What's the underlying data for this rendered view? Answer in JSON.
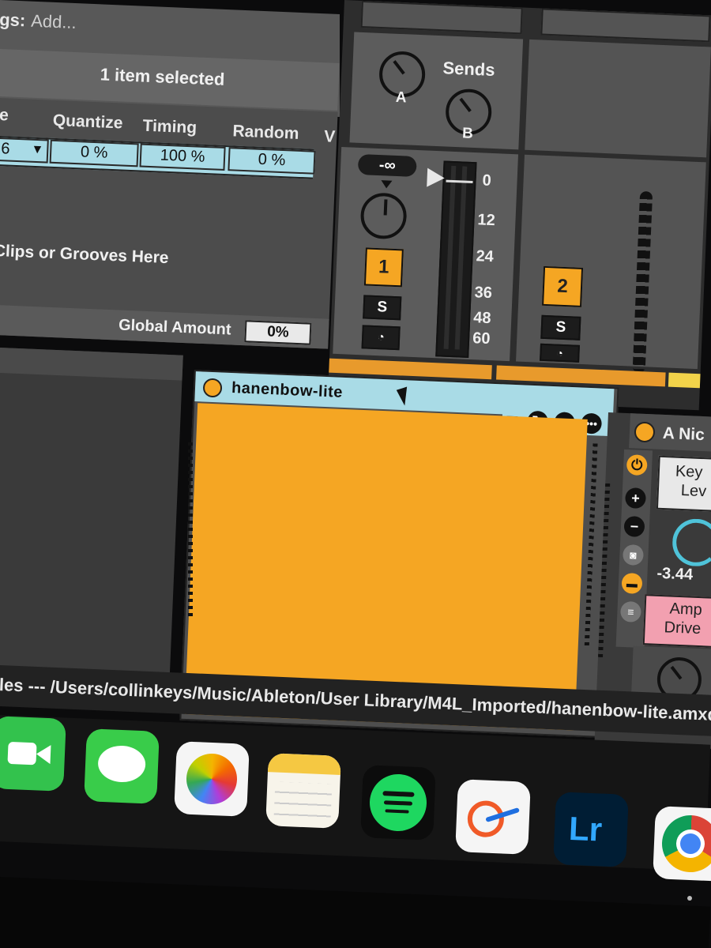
{
  "browser": {
    "tags_label": "gs:",
    "tags_placeholder": "Add...",
    "selection_status": "1 item selected"
  },
  "groove": {
    "col_partial_left": "e",
    "columns": [
      "Quantize",
      "Timing",
      "Random",
      "V"
    ],
    "row_partial_left": "6",
    "values": [
      "0 %",
      "100 %",
      "0 %"
    ],
    "drop_hint": "Clips or Grooves Here",
    "global_amount_label": "Global Amount",
    "global_amount_value": "0%"
  },
  "mixer": {
    "sends_label": "Sends",
    "send_a": "A",
    "send_b": "B",
    "volume_readout": "-∞",
    "meter_ticks": [
      "0",
      "12",
      "24",
      "36",
      "48",
      "60"
    ],
    "track1": {
      "number": "1",
      "solo": "S"
    },
    "track2": {
      "number": "2",
      "solo": "S"
    }
  },
  "device": {
    "title": "hanenbow-lite",
    "accent": "#f5a623"
  },
  "second_device": {
    "title": "A Nic",
    "key_label_1": "Key",
    "key_label_2": "Lev",
    "knob_value": "-3.44",
    "amp_label_1": "Amp",
    "amp_label_2": "Drive",
    "bottom_knob_value": "0"
  },
  "status_bar": {
    "path": "les --- /Users/collinkeys/Music/Ableton/User Library/M4L_Imported/hanenbow-lite.amxd"
  },
  "dock": {
    "apps": [
      "facetime-icon",
      "messages-icon",
      "photos-icon",
      "notes-icon",
      "spotify-icon",
      "freeform-icon",
      "lightroom-icon",
      "chrome-icon"
    ],
    "lightroom_text": "Lr"
  }
}
